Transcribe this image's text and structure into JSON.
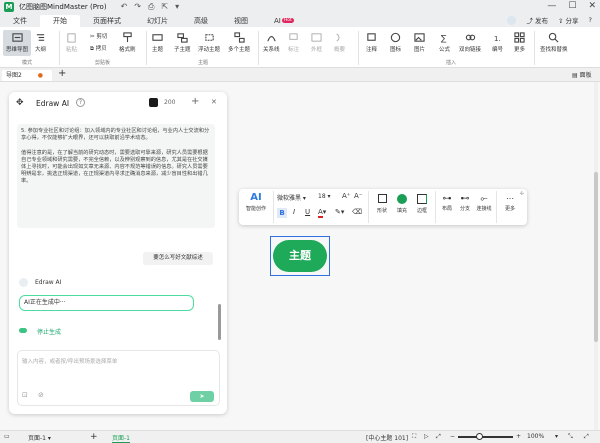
{
  "app": {
    "title": "亿图脑图MindMaster (Pro)",
    "logo_text": "M",
    "quick_icons": [
      "↶",
      "↷",
      "🖨",
      "⤢",
      "▾"
    ]
  },
  "menu": {
    "items": [
      "文件",
      "开始",
      "页面样式",
      "幻灯片",
      "高级",
      "视图",
      "AI"
    ],
    "active": "开始",
    "ai_badge": "Hot",
    "right": {
      "publish": "发布",
      "share": "分享",
      "help": "?"
    }
  },
  "ribbon": {
    "mode": {
      "mindmap": "思维导图",
      "outline": "大纲",
      "group": "模式"
    },
    "clipboard": {
      "paste": "粘贴",
      "cut": "剪切",
      "copy": "拷贝",
      "format_painter": "格式刷",
      "group": "剪贴板"
    },
    "topic": {
      "main": "主题",
      "sub": "子主题",
      "float": "浮动主题",
      "multi": "多个主题",
      "group": "主题"
    },
    "relation": {
      "relation": "关系线",
      "tag": "标注",
      "frame": "外框",
      "summary": "概要",
      "group": ""
    },
    "insert": {
      "comment": "注释",
      "icon": "图标",
      "image": "图片",
      "formula": "公式",
      "link": "双向链接",
      "number": "编号",
      "more": "更多",
      "group": "插入"
    },
    "find": {
      "label": "查找和替换"
    }
  },
  "tabs": {
    "doc_tab": "导图2",
    "add": "+",
    "right_panel": "面板"
  },
  "ai_panel": {
    "title": "Edraw AI",
    "help": "?",
    "credits": "200",
    "add": "+",
    "close": "✕",
    "message_text": "5. 参加专业社区和讨论组：加入领域内的专业社区和讨论组，与业内人士交流和分享心得，不仅能够扩大眼界，还可以获取前沿学术动态。\n\n值得注意的是，在了解当前的研究动态时，需要选取可靠来源，研究人员需要根据自己专业领域和研究需要，不完全信赖，以及辨别观察到的信息，尤其是在社交媒体上寻找时，可能会出现如文章无来源、内容不规范等错误的信息。研究人员需要明辨是非，挑选正规渠道，在正规渠道内寻求正确消息来源，减少盲目性和出错几率。",
    "user_question": "要怎么写好文献综述",
    "bot_name": "Edraw AI",
    "generating_text": "AI正在生成中···",
    "stop_label": "停止生成",
    "input_placeholder": "输入内容，或者按/呼出预场景选择菜单"
  },
  "float_toolbar": {
    "ai_label": "AI",
    "ai_sub": "智能创作",
    "font": "微软雅黑",
    "size": "18",
    "bold": "B",
    "italic": "I",
    "underline": "U",
    "shape": "形状",
    "fill": "填充",
    "border": "边框",
    "layout": "布局",
    "branch": "分支",
    "connector": "连接线",
    "more": "更多",
    "fill_color": "#1a9e55"
  },
  "canvas": {
    "topic_text": "主题",
    "topic_color": "#1faa5a",
    "selection_color": "#2f6fe0"
  },
  "status": {
    "page_selector": "页面-1",
    "page_tab": "页面-1",
    "center_info": "[中心主题 101]",
    "zoom": "100%"
  }
}
